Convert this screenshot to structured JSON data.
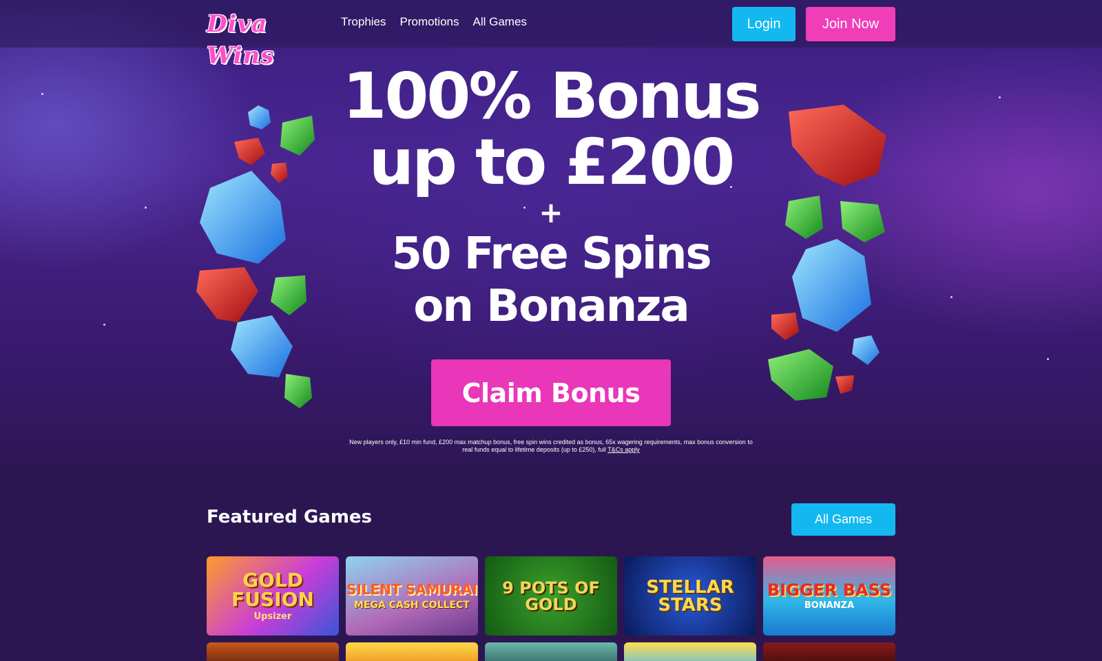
{
  "brand": {
    "logo_text": "Diva Wins"
  },
  "nav": {
    "items": [
      {
        "label": "Trophies"
      },
      {
        "label": "Promotions"
      },
      {
        "label": "All Games"
      }
    ],
    "login_label": "Login",
    "join_label": "Join Now"
  },
  "hero": {
    "line1": "100% Bonus",
    "line2": "up to £200",
    "plus": "+",
    "line3": "50 Free Spins",
    "line4": "on Bonanza",
    "cta_label": "Claim Bonus",
    "terms_text": "New players only, £10 min fund, £200 max matchup bonus, free spin wins credited as bonus, 65x wagering requirements, max bonus conversion to real funds equal to lifetime deposits (up to £250), full",
    "terms_link": "T&Cs apply"
  },
  "featured": {
    "title": "Featured Games",
    "all_games_label": "All Games",
    "games": [
      {
        "name": "GOLD FUSION",
        "sub": "Upsizer"
      },
      {
        "name": "SILENT SAMURAI",
        "sub": "MEGA CASH COLLECT"
      },
      {
        "name": "9 POTS OF GOLD",
        "sub": ""
      },
      {
        "name": "STELLAR STARS",
        "sub": ""
      },
      {
        "name": "BIGGER BASS",
        "sub": "BONANZA"
      }
    ]
  },
  "colors": {
    "accent_blue": "#14b8f0",
    "accent_pink": "#f03db8",
    "background": "#2c1652"
  }
}
